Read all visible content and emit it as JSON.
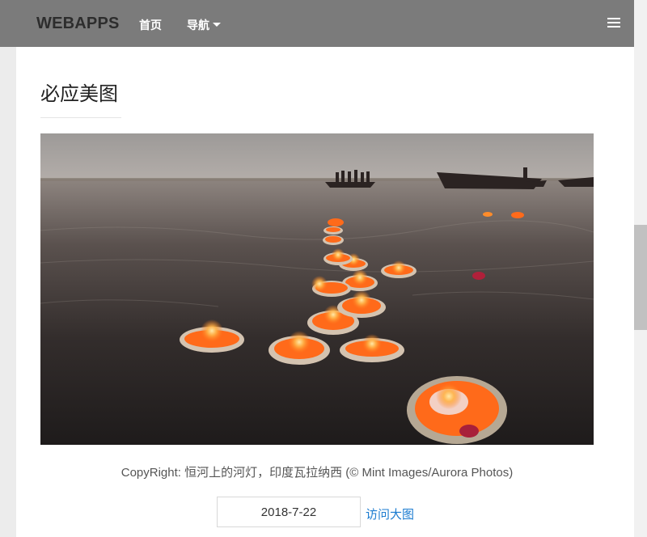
{
  "navbar": {
    "brand": "WEBAPPS",
    "home_label": "首页",
    "nav_label": "导航",
    "menu_icon": "hamburger-icon"
  },
  "main": {
    "title": "必应美图",
    "photo_alt": "恒河上的河灯，印度瓦拉纳西",
    "copyright": "CopyRight: 恒河上的河灯，印度瓦拉纳西 (© Mint Images/Aurora Photos)",
    "date": "2018-7-22",
    "visit_link": "访问大图"
  },
  "colors": {
    "navbar_bg": "#7b7b7b",
    "link": "#1a7bd0",
    "flame": "#ff7a1a"
  }
}
